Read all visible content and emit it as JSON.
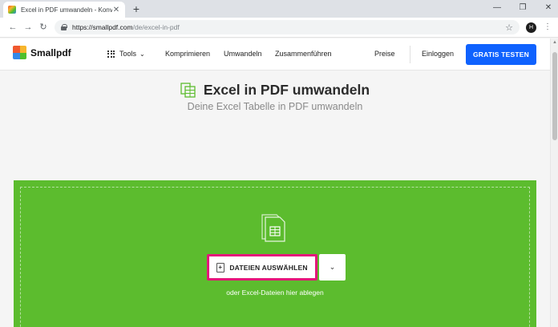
{
  "browser": {
    "tab_title": "Excel in PDF umwandeln - Konve",
    "tab_close": "✕",
    "new_tab": "+",
    "win_min": "—",
    "win_restore": "❐",
    "win_close": "✕",
    "back": "←",
    "forward": "→",
    "reload": "↻",
    "url_host": "https://smallpdf.com",
    "url_path": "/de/excel-in-pdf",
    "bookmark_star": "☆",
    "profile_initial": "H",
    "menu": "⋮"
  },
  "nav": {
    "logo_text": "Smallpdf",
    "tools": "Tools",
    "compress": "Komprimieren",
    "convert": "Umwandeln",
    "merge": "Zusammenführen",
    "pricing": "Preise",
    "login": "Einloggen",
    "cta": "GRATIS TESTEN"
  },
  "hero": {
    "title": "Excel in PDF umwandeln",
    "subtitle": "Deine Excel Tabelle in PDF umwandeln"
  },
  "dropzone": {
    "choose_label": "DATEIEN AUSWÄHLEN",
    "dropdown": "⌄",
    "hint": "oder Excel-Dateien hier ablegen"
  },
  "colors": {
    "dropzone_green": "#5cbc2e",
    "cta_blue": "#0f62fe",
    "highlight_pink": "#e4177b"
  },
  "icons": {
    "favicon": "smallpdf-favicon",
    "lock": "lock-icon",
    "excel": "excel-icon",
    "document_stack": "document-stack-icon",
    "file_add": "file-add-icon"
  }
}
